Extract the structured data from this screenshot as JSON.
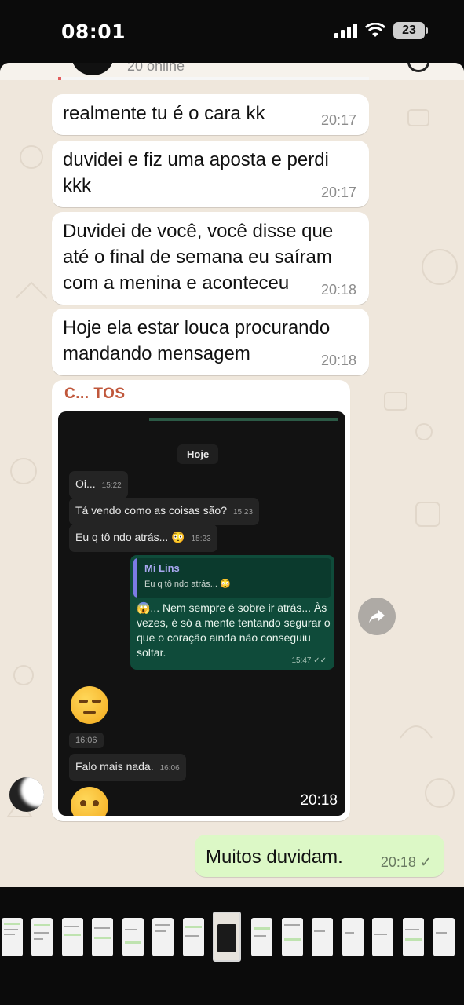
{
  "status_bar": {
    "time": "08:01",
    "battery": "23"
  },
  "header": {
    "subtitle": "20 online"
  },
  "messages": [
    {
      "text": "realmente tu é o cara kk",
      "time": "20:17"
    },
    {
      "text": "duvidei e fiz uma aposta e perdi kkk",
      "time": "20:17"
    },
    {
      "text": "Duvidei de você, você disse que até o final de semana eu saíram com a menina e aconteceu",
      "time": "20:18"
    },
    {
      "text": "Hoje ela estar louca procurando mandando mensagem",
      "time": "20:18"
    }
  ],
  "forwarded": {
    "sender": "C... TOS",
    "time": "20:18",
    "screenshot": {
      "date_chip": "Hoje",
      "incoming": [
        {
          "text": "Oi...",
          "time": "15:22"
        },
        {
          "text": "Tá vendo como as coisas são?",
          "time": "15:23"
        },
        {
          "text": "Eu q tô ndo atrás... 😳",
          "time": "15:23"
        }
      ],
      "reply": {
        "quote_name": "Mi Lins",
        "quote_text": "Eu q tô ndo atrás... 😳",
        "body": "😱... Nem sempre é sobre ir atrás... Às vezes, é só a mente tentando segurar o que o coração ainda não conseguiu soltar.",
        "time": "15:47 ✓✓"
      },
      "emoji_time": "16:06",
      "last_incoming": {
        "text": "Falo mais nada.",
        "time": "16:06"
      }
    }
  },
  "outgoing": {
    "text": "Muitos duvidam.",
    "time": "20:18 ✓"
  },
  "colors": {
    "chat_bg": "#efe7dc",
    "outgoing_bubble": "#dcf8c6",
    "dark_green": "#0f4b3a"
  }
}
